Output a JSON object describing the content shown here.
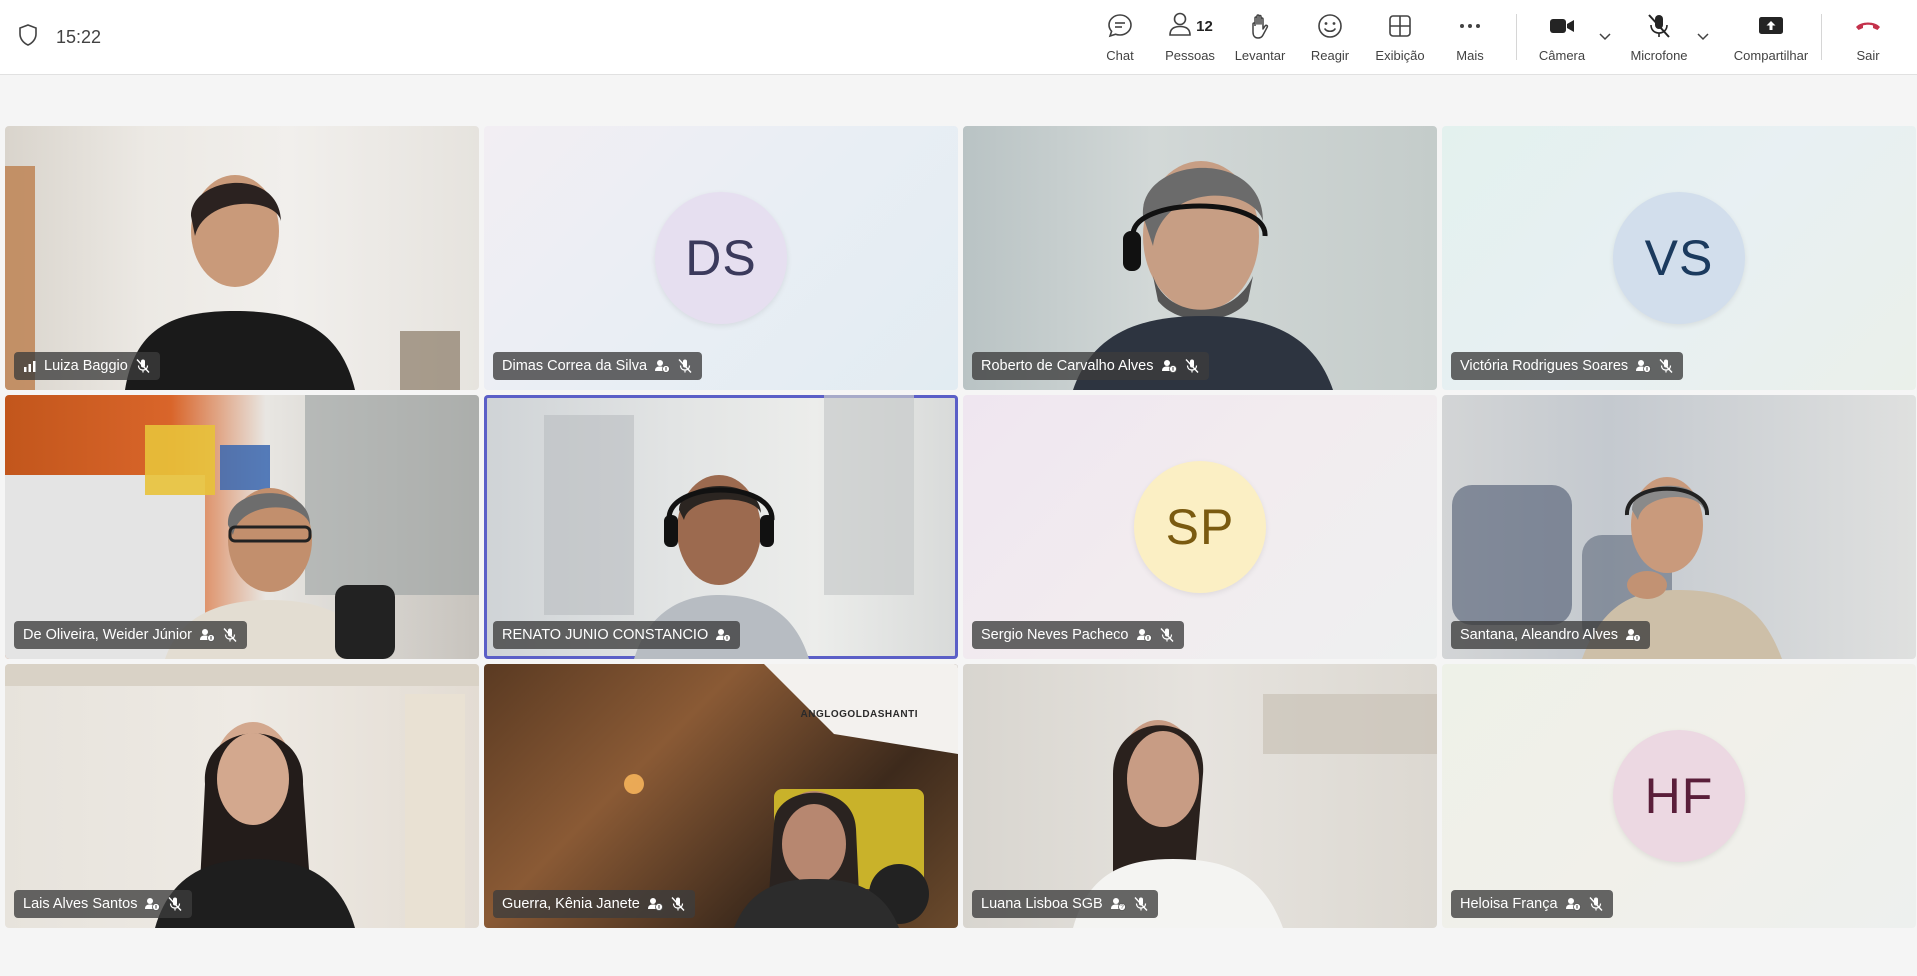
{
  "meeting": {
    "clock": "15:22"
  },
  "toolbar": {
    "chat_label": "Chat",
    "people_label": "Pessoas",
    "people_count": "12",
    "raise_label": "Levantar",
    "react_label": "Reagir",
    "view_label": "Exibição",
    "more_label": "Mais",
    "camera_label": "Câmera",
    "mic_label": "Microfone",
    "share_label": "Compartilhar",
    "leave_label": "Sair",
    "leave_color": "#c4314b"
  },
  "participants": [
    {
      "name": "Luiza Baggio",
      "status_icon": "signal-icon",
      "muted": true,
      "video": true
    },
    {
      "name": "Dimas Correa da Silva",
      "initials": "DS",
      "status_icon": "org-icon",
      "muted": true,
      "video": false,
      "avatar_bg": "#e6dff0",
      "avatar_fg": "#3b3a5c"
    },
    {
      "name": "Roberto de Carvalho Alves",
      "status_icon": "org-icon",
      "muted": true,
      "video": true
    },
    {
      "name": "Victória Rodrigues Soares",
      "initials": "VS",
      "status_icon": "org-icon",
      "muted": true,
      "video": false,
      "avatar_bg": "#d2deec",
      "avatar_fg": "#1b3a5e"
    },
    {
      "name": "De Oliveira, Weider Júnior",
      "status_icon": "org-icon",
      "muted": true,
      "video": true
    },
    {
      "name": "RENATO JUNIO CONSTANCIO",
      "status_icon": "org-icon",
      "muted": false,
      "video": true,
      "speaking": true
    },
    {
      "name": "Sergio Neves Pacheco",
      "initials": "SP",
      "status_icon": "org-icon",
      "muted": true,
      "video": false,
      "avatar_bg": "#fbefc4",
      "avatar_fg": "#7a5a10"
    },
    {
      "name": "Santana, Aleandro Alves",
      "status_icon": "org-icon",
      "muted": false,
      "video": true
    },
    {
      "name": "Lais Alves Santos",
      "status_icon": "org-icon",
      "muted": true,
      "video": true
    },
    {
      "name": "Guerra, Kênia Janete",
      "status_icon": "org-icon",
      "muted": true,
      "video": true,
      "background_logo": "ANGLOGOLDASHANTI"
    },
    {
      "name": "Luana Lisboa SGB",
      "status_icon": "unknown-org-icon",
      "muted": true,
      "video": true
    },
    {
      "name": "Heloisa França",
      "initials": "HF",
      "status_icon": "org-icon",
      "muted": true,
      "video": false,
      "avatar_bg": "#ecd8e2",
      "avatar_fg": "#5a1e3a"
    }
  ]
}
